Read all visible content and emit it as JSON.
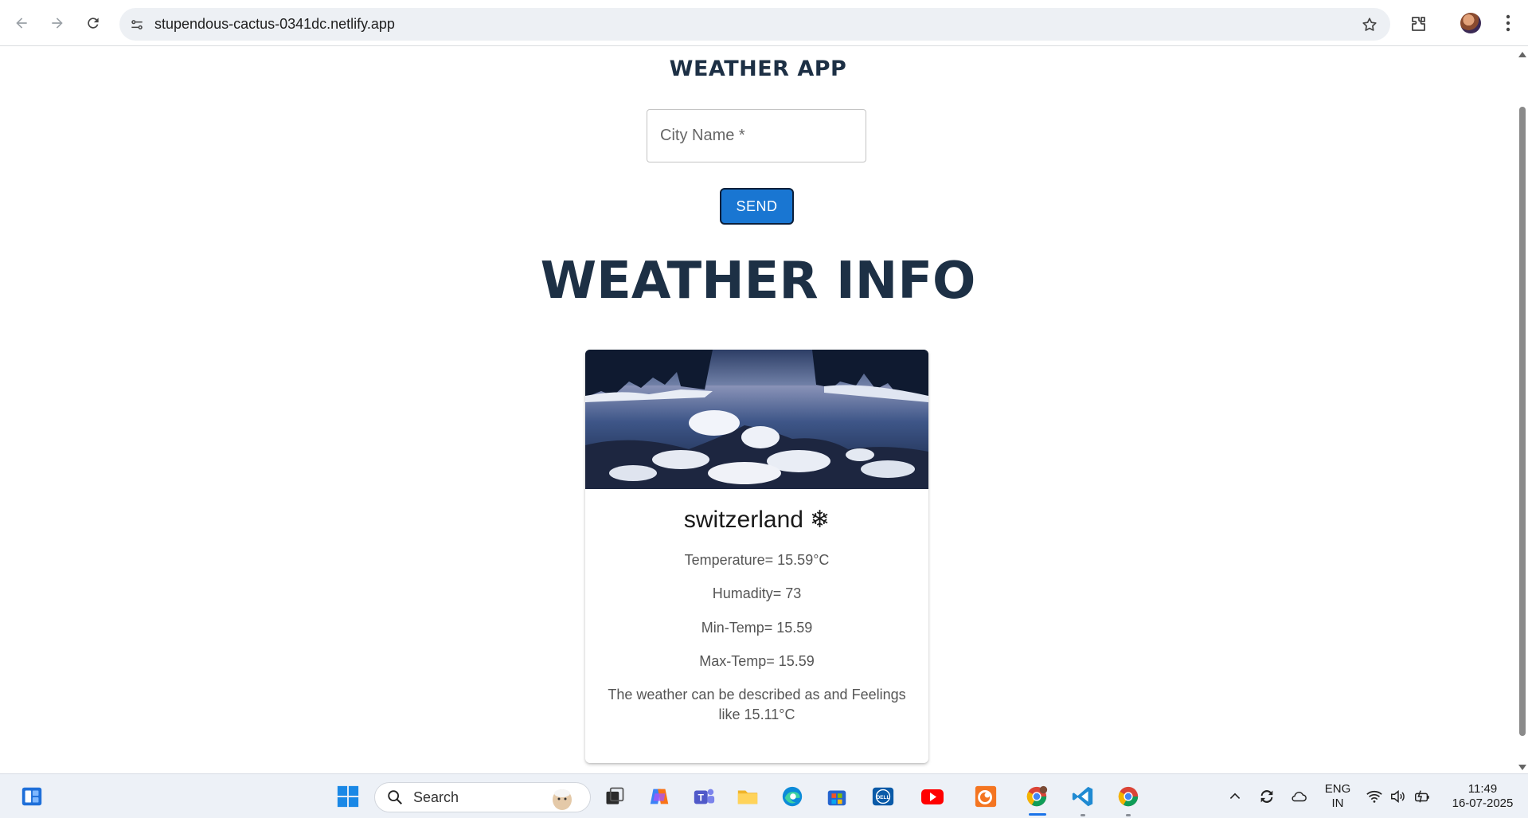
{
  "browser": {
    "url": "stupendous-cactus-0341dc.netlify.app"
  },
  "page": {
    "app_title": "WEATHER APP",
    "city_placeholder": "City Name *",
    "city_value": "",
    "send_label": "SEND",
    "info_heading": "WEATHER INFO",
    "card": {
      "city": "switzerland",
      "weather_icon": "snowflake-icon",
      "temperature": "Temperature= 15.59°C",
      "humidity": "Humadity= 73",
      "min_temp": "Min-Temp= 15.59",
      "max_temp": "Max-Temp= 15.59",
      "description": "The weather can be described as and Feelings like 15.11°C"
    }
  },
  "taskbar": {
    "search_label": "Search",
    "language": "ENG",
    "region": "IN",
    "time": "11:49",
    "date": "16-07-2025",
    "pinned": [
      "widgets-icon",
      "start-icon",
      "task-view-icon",
      "copilot-icon",
      "teams-icon",
      "file-explorer-icon",
      "edge-icon",
      "store-icon",
      "dell-icon",
      "youtube-icon",
      "crunchyroll-icon",
      "chrome-icon",
      "vscode-icon",
      "chrome-icon"
    ]
  },
  "colors": {
    "heading": "#1d3045",
    "send_button": "#1976d2",
    "page_background": "#ffffff"
  }
}
